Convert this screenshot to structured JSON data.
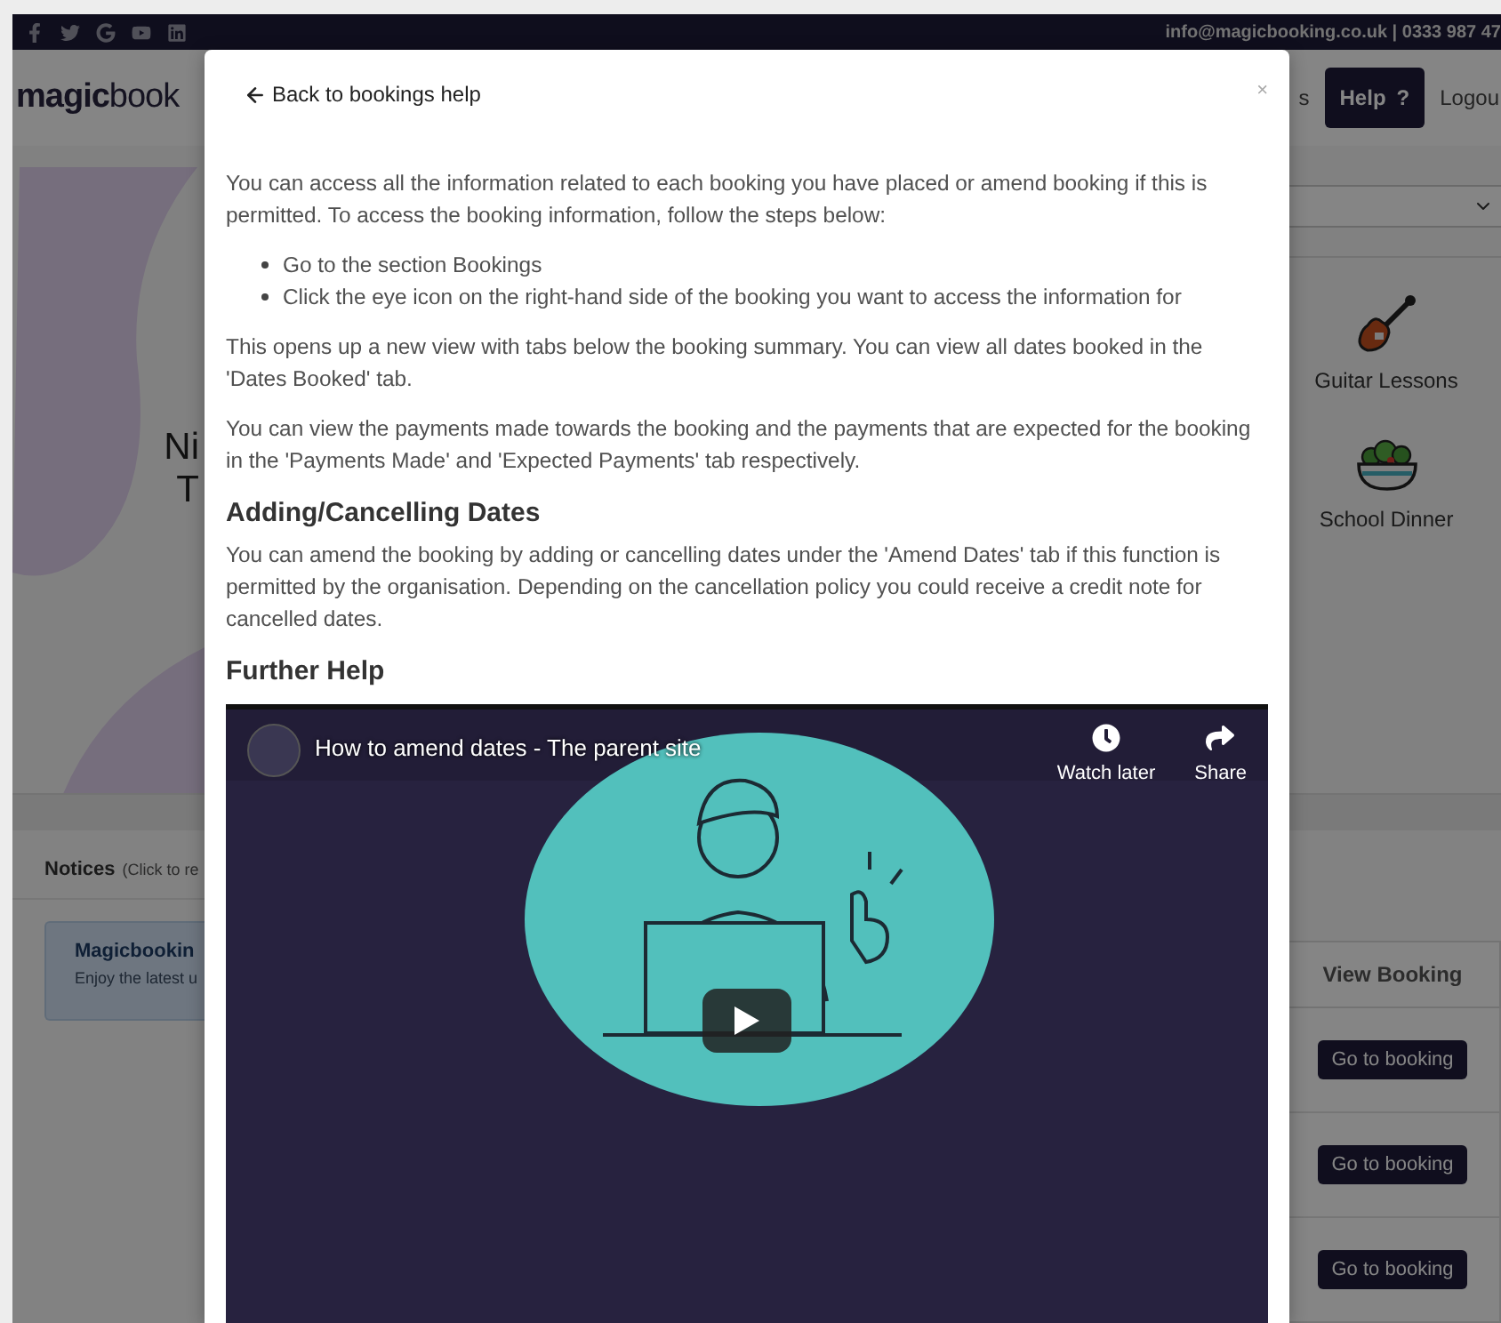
{
  "top_bar": {
    "contact": "info@magicbooking.co.uk | 0333 987 47"
  },
  "navbar": {
    "logo": "**magic**book",
    "items": [
      {
        "kind": "link",
        "label": "s"
      },
      {
        "kind": "button",
        "label": "Help",
        "icon": "?"
      },
      {
        "kind": "link",
        "label": "Logou"
      }
    ]
  },
  "hero": {
    "heading_lines": [
      "Ni",
      "T"
    ]
  },
  "categories": [
    {
      "kind": "guitar",
      "label": "Guitar Lessons"
    },
    {
      "kind": "salad",
      "label": "School Dinner"
    }
  ],
  "notices": {
    "title": "Notices",
    "hint": "(Click to re",
    "cards": [
      {
        "title": "Magicbookin",
        "text": "Enjoy the latest u"
      }
    ]
  },
  "bookings_table": {
    "columns": [
      "View Booking"
    ],
    "rows": [
      {
        "action": "Go to booking"
      },
      {
        "action": "Go to booking"
      },
      {
        "action": "Go to booking"
      }
    ]
  },
  "modal": {
    "back_link": "Back to bookings help",
    "close": "×",
    "blocks": [
      {
        "kind": "paragraph",
        "text": "You can access all the information related to each booking you have placed or amend booking if this is permitted. To access the booking information, follow the steps below:"
      },
      {
        "kind": "list",
        "items": [
          "Go to the section Bookings",
          "Click the eye icon on the right-hand side of the booking you want to access the information for"
        ]
      },
      {
        "kind": "paragraph",
        "text": "This opens up a new view with tabs below the booking summary. You can view all dates booked in the 'Dates Booked' tab."
      },
      {
        "kind": "paragraph",
        "text": "You can view the payments made towards the booking and the payments that are expected for the booking in the 'Payments Made' and 'Expected Payments' tab respectively."
      },
      {
        "kind": "heading",
        "text": "Adding/Cancelling Dates"
      },
      {
        "kind": "paragraph",
        "text": "You can amend the booking by adding or cancelling dates under the 'Amend Dates' tab if this function is permitted by the organisation. Depending on the cancellation policy you could receive a credit note for cancelled dates."
      },
      {
        "kind": "heading",
        "text": "Further Help"
      },
      {
        "kind": "video",
        "title": "How to amend dates - The parent site",
        "actions": [
          {
            "kind": "clock",
            "label": "Watch later"
          },
          {
            "kind": "share",
            "label": "Share"
          }
        ]
      }
    ]
  }
}
